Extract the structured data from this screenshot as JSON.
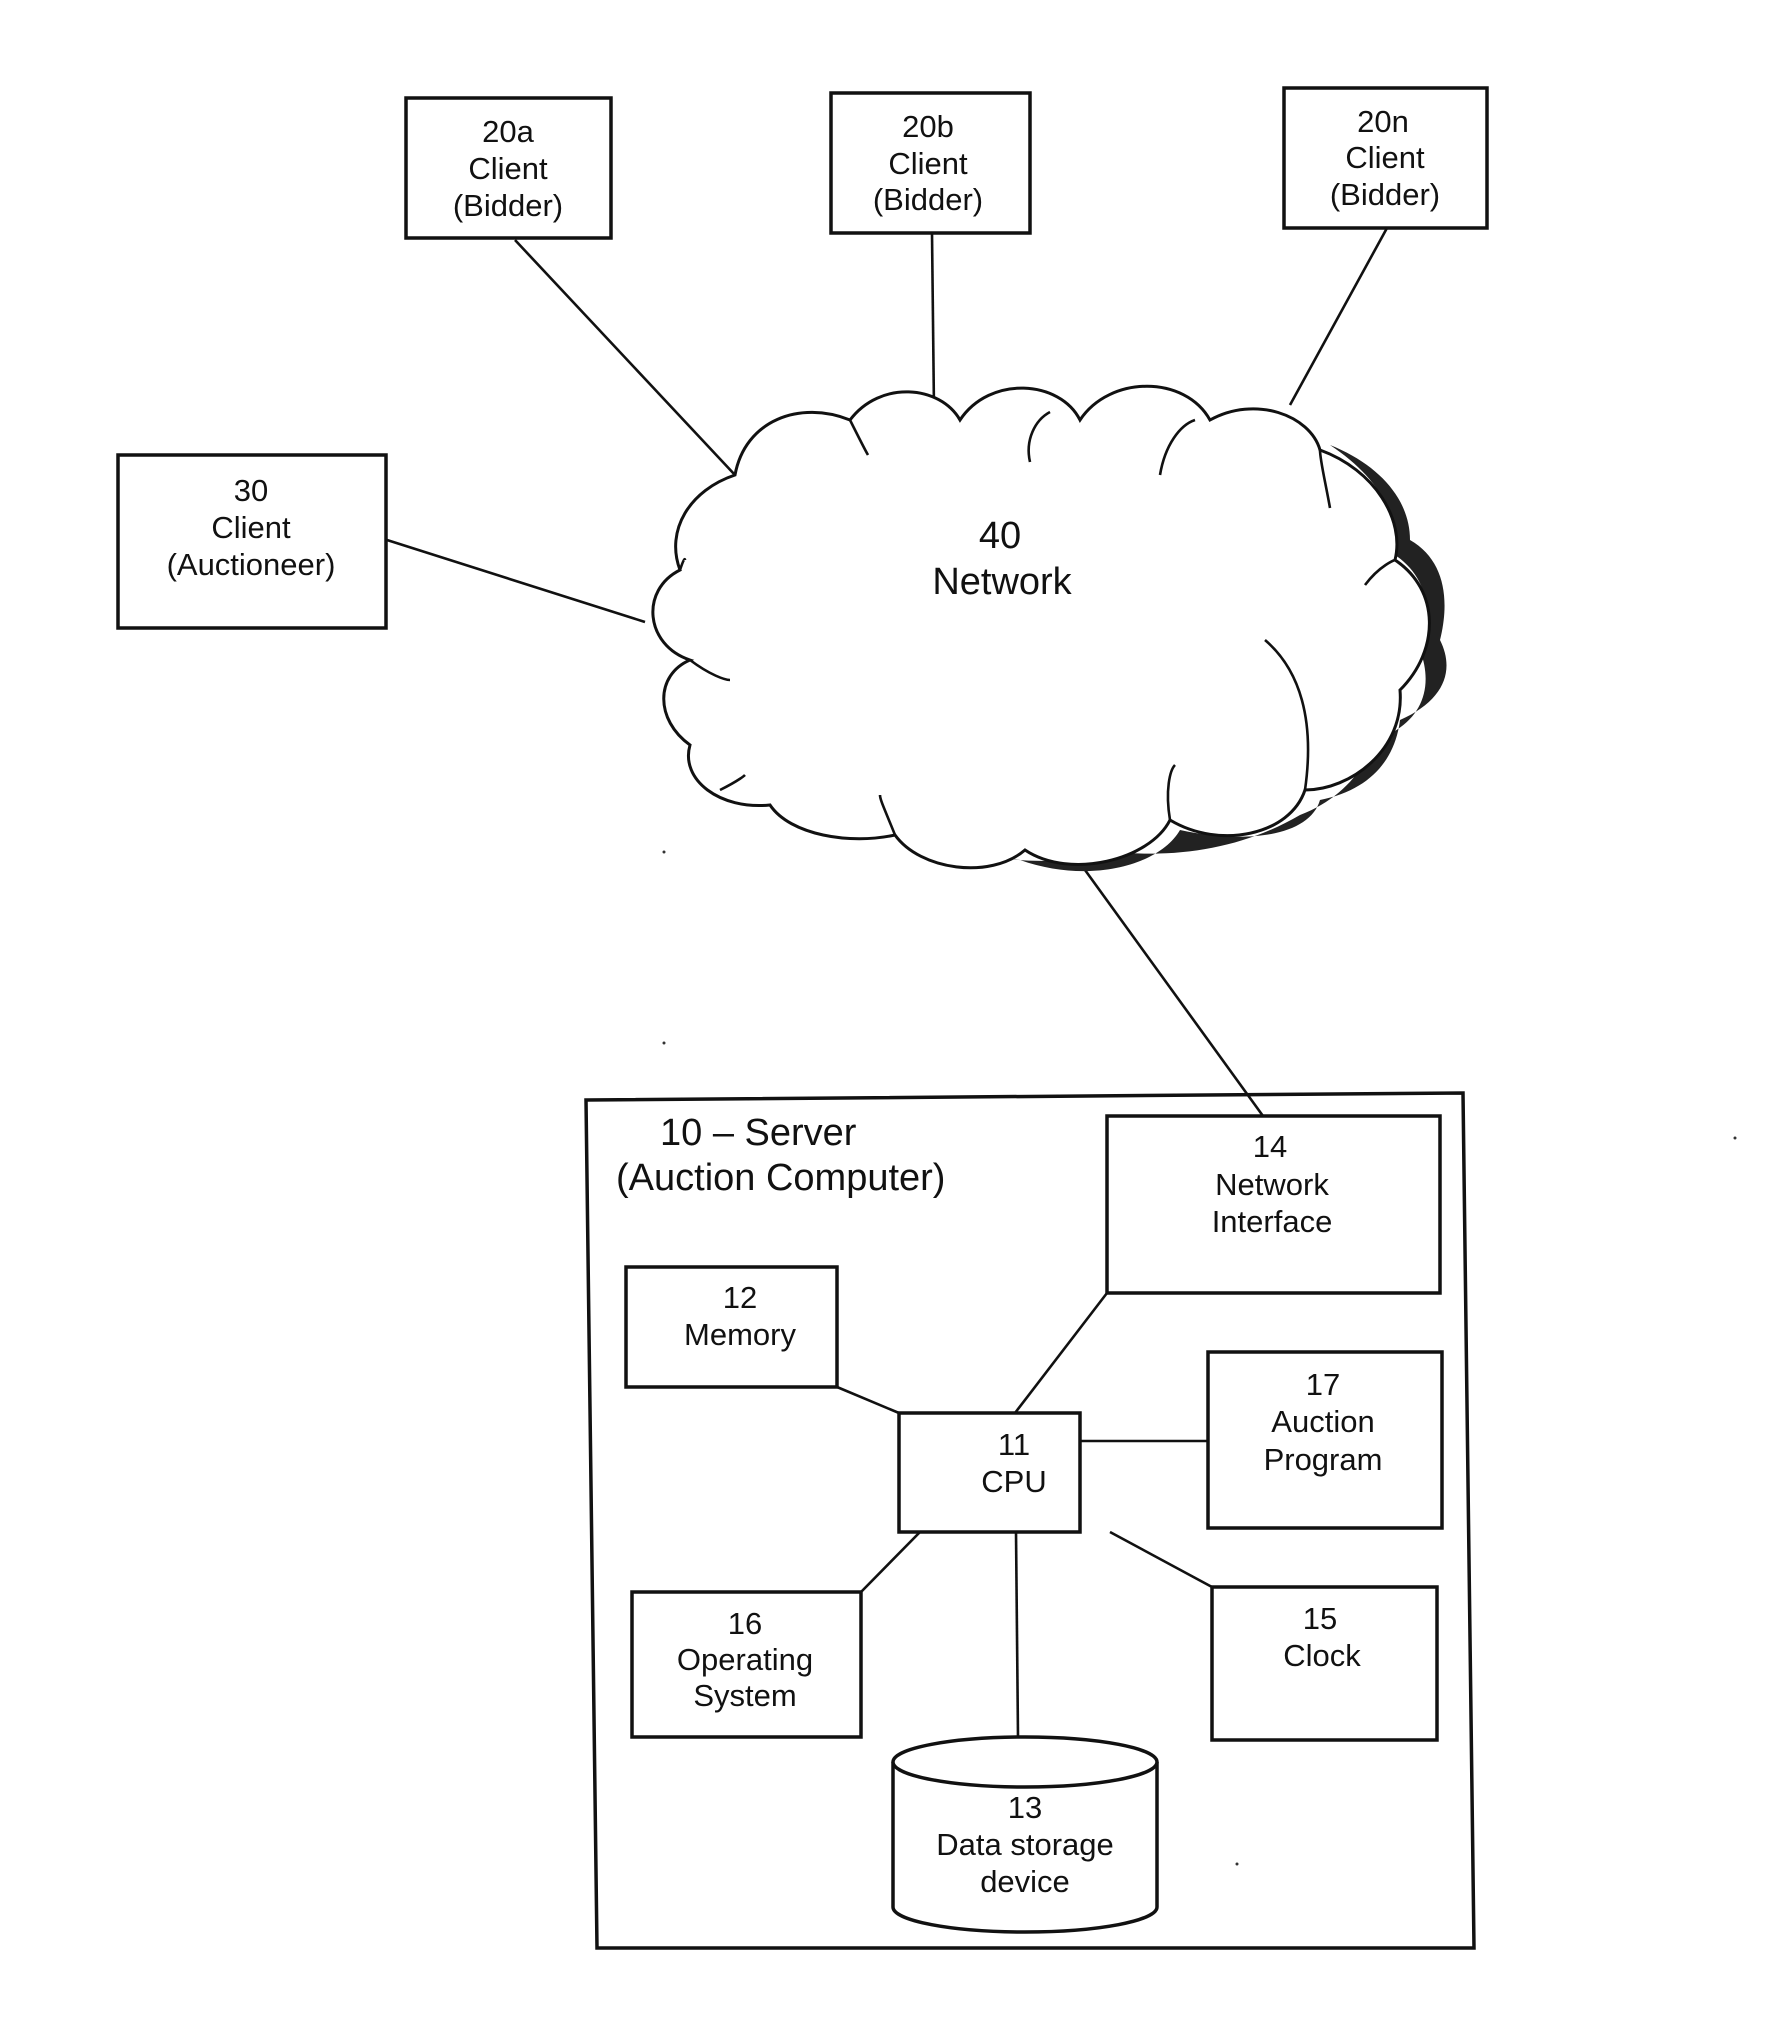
{
  "diagram": {
    "network": {
      "number": "40",
      "label": "Network"
    },
    "clients": [
      {
        "id": "client-20a",
        "number": "20a",
        "line1": "Client",
        "line2": "(Bidder)"
      },
      {
        "id": "client-20b",
        "number": "20b",
        "line1": "Client",
        "line2": "(Bidder)"
      },
      {
        "id": "client-20n",
        "number": "20n",
        "line1": "Client",
        "line2": "(Bidder)"
      },
      {
        "id": "client-30",
        "number": "30",
        "line1": "Client",
        "line2": "(Auctioneer)"
      }
    ],
    "server": {
      "title_line1": "10 – Server",
      "title_line2": "(Auction Computer)",
      "components": {
        "cpu": {
          "number": "11",
          "line1": "CPU"
        },
        "memory": {
          "number": "12",
          "line1": "Memory"
        },
        "storage": {
          "number": "13",
          "line1": "Data storage",
          "line2": "device"
        },
        "network_interface": {
          "number": "14",
          "line1": "Network",
          "line2": "Interface"
        },
        "clock": {
          "number": "15",
          "line1": "Clock"
        },
        "os": {
          "number": "16",
          "line1": "Operating",
          "line2": "System"
        },
        "auction_program": {
          "number": "17",
          "line1": "Auction",
          "line2": "Program"
        }
      }
    }
  }
}
